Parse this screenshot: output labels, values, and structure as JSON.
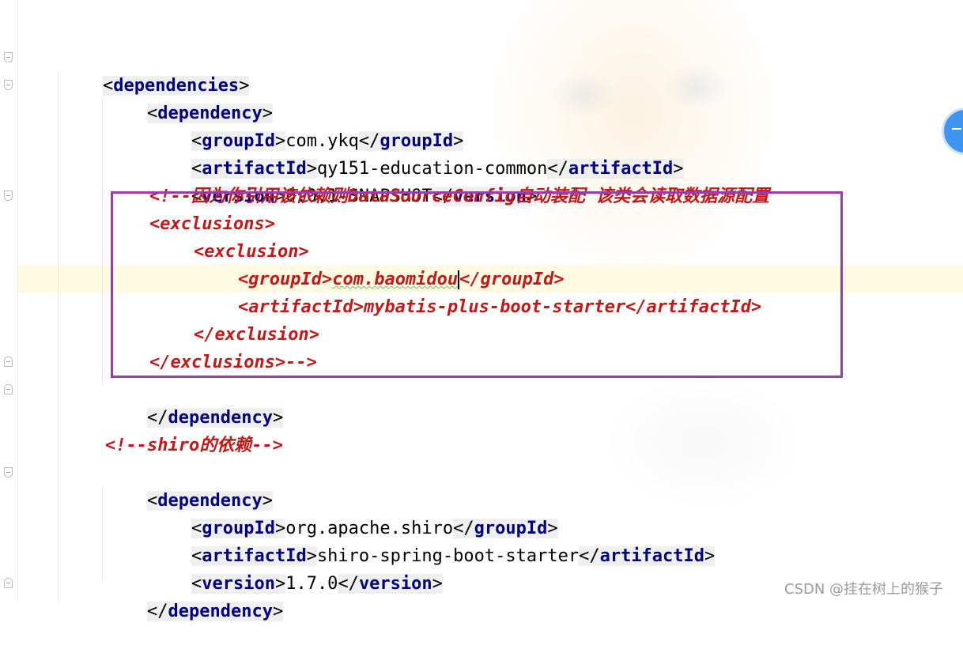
{
  "editor": {
    "lines": [
      {
        "tag": "dependencies",
        "type": "open"
      },
      {
        "tag": "dependency",
        "type": "open"
      },
      {
        "tag": "groupId",
        "value": "com.ykq"
      },
      {
        "tag": "artifactId",
        "value": "qy151-education-common"
      },
      {
        "tag": "version",
        "value": "0.0.1-SNAPSHOT"
      },
      {
        "comment": "<!--因为你引用该依赖则DataSourceConfig自动装配 该类会读取数据源配置"
      },
      {
        "comment": "<exclusions>"
      },
      {
        "comment": "<exclusion>"
      },
      {
        "comment_tag": "groupId",
        "comment_value": "com.baomidou"
      },
      {
        "comment": "<artifactId>mybatis-plus-boot-starter</artifactId>"
      },
      {
        "comment": "</exclusion>"
      },
      {
        "comment": "</exclusions>-->"
      },
      {
        "tag": "dependency",
        "type": "close"
      },
      {
        "comment": "<!--shiro的依赖-->"
      },
      {
        "tag": "dependency",
        "type": "open"
      },
      {
        "tag": "groupId",
        "value": "org.apache.shiro"
      },
      {
        "tag": "artifactId",
        "value": "shiro-spring-boot-starter"
      },
      {
        "tag": "version",
        "value": "1.7.0"
      },
      {
        "tag": "dependency",
        "type": "close"
      }
    ]
  },
  "highlight_box_color": "#9b3fa6",
  "watermark": "CSDN @挂在树上的猴子",
  "colors": {
    "tag": "#000080",
    "comment": "#c41818",
    "current_line": "#fff9dc"
  },
  "icons": {
    "fold_marker": "fold-marker-icon",
    "scroll_widget": "scroll-widget-icon"
  }
}
